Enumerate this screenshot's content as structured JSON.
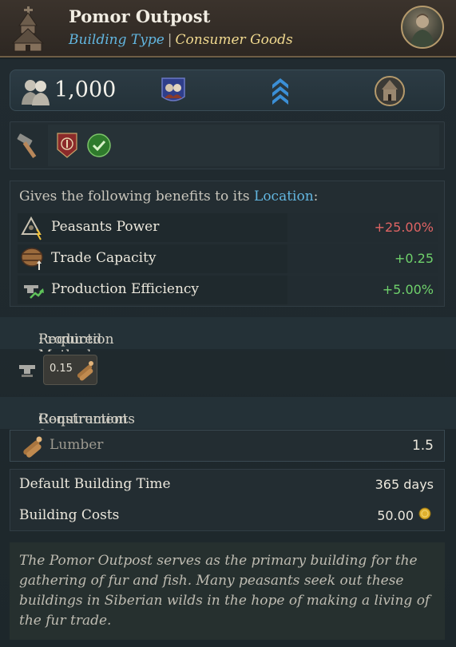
{
  "header": {
    "title": "Pomor Outpost",
    "type_label": "Building Type",
    "separator": "|",
    "category": "Consumer Goods"
  },
  "stats": {
    "population": "1,000"
  },
  "benefits": {
    "intro_prefix": "Gives the following benefits to its ",
    "intro_link": "Location",
    "intro_suffix": ":",
    "rows": [
      {
        "icon": "peasants-power-icon",
        "label": "Peasants Power",
        "value": "+25.00%",
        "tone": "negative"
      },
      {
        "icon": "trade-capacity-icon",
        "label": "Trade Capacity",
        "value": "+0.25",
        "tone": "positive"
      },
      {
        "icon": "production-efficiency-icon",
        "label": "Production Efficiency",
        "value": "+5.00%",
        "tone": "positive"
      }
    ]
  },
  "production": {
    "prefix": "Required ",
    "link": "Production Method",
    "suffix": ":",
    "chip_value": "0.15"
  },
  "requirements": {
    "prefix": "Requirements for ",
    "link": "Construction",
    "suffix": ":",
    "item_label": "Lumber",
    "item_value": "1.5"
  },
  "info": {
    "time_label": "Default Building Time",
    "time_value": "365 days",
    "cost_label": "Building Costs",
    "cost_value": "50.00"
  },
  "description": "The Pomor Outpost serves as the primary building for the gathering of fur and fish. Many peasants seek out these buildings in Siberian wilds in the hope of making a living of the fur trade.",
  "colors": {
    "link": "#62b6e0",
    "category": "#f0d98f",
    "negative": "#e06464",
    "positive": "#6fd16b"
  }
}
